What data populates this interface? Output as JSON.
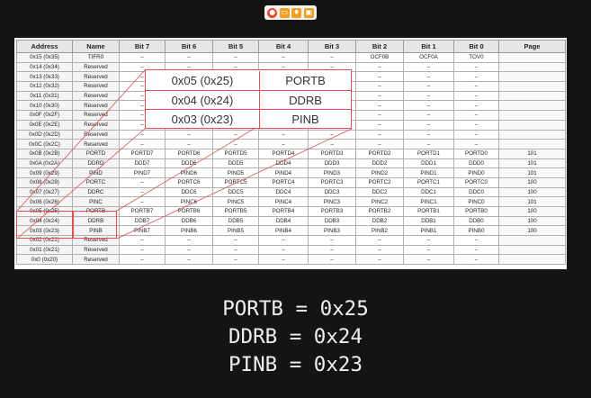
{
  "toolbar": {
    "icons": [
      "record-icon",
      "folder-icon",
      "mic-icon",
      "window-icon"
    ]
  },
  "table": {
    "headers": [
      "Address",
      "Name",
      "Bit 7",
      "Bit 6",
      "Bit 5",
      "Bit 4",
      "Bit 3",
      "Bit 2",
      "Bit 1",
      "Bit 0",
      "Page"
    ],
    "rows": [
      [
        "0x15 (0x35)",
        "TIFR0",
        "–",
        "–",
        "–",
        "–",
        "–",
        "OCF0B",
        "OCF0A",
        "TOV0",
        ""
      ],
      [
        "0x14 (0x34)",
        "Reserved",
        "–",
        "–",
        "–",
        "–",
        "–",
        "–",
        "–",
        "–",
        ""
      ],
      [
        "0x13 (0x33)",
        "Reserved",
        "–",
        "–",
        "–",
        "–",
        "–",
        "–",
        "–",
        "–",
        ""
      ],
      [
        "0x12 (0x32)",
        "Reserved",
        "–",
        "–",
        "–",
        "–",
        "–",
        "–",
        "–",
        "–",
        ""
      ],
      [
        "0x11 (0x31)",
        "Reserved",
        "–",
        "–",
        "–",
        "–",
        "–",
        "–",
        "–",
        "–",
        ""
      ],
      [
        "0x10 (0x30)",
        "Reserved",
        "–",
        "–",
        "–",
        "–",
        "–",
        "–",
        "–",
        "–",
        ""
      ],
      [
        "0x0F (0x2F)",
        "Reserved",
        "–",
        "–",
        "–",
        "–",
        "–",
        "–",
        "–",
        "–",
        ""
      ],
      [
        "0x0E (0x2E)",
        "Reserved",
        "–",
        "–",
        "–",
        "–",
        "–",
        "–",
        "–",
        "–",
        ""
      ],
      [
        "0x0D (0x2D)",
        "Reserved",
        "–",
        "–",
        "–",
        "–",
        "–",
        "–",
        "–",
        "–",
        ""
      ],
      [
        "0x0C (0x2C)",
        "Reserved",
        "–",
        "–",
        "–",
        "–",
        "–",
        "–",
        "–",
        "–",
        ""
      ],
      [
        "0x0B (0x2B)",
        "PORTD",
        "PORTD7",
        "PORTD6",
        "PORTD5",
        "PORTD4",
        "PORTD3",
        "PORTD2",
        "PORTD1",
        "PORTD0",
        "101"
      ],
      [
        "0x0A (0x2A)",
        "DDRD",
        "DDD7",
        "DDD6",
        "DDD5",
        "DDD4",
        "DDD3",
        "DDD2",
        "DDD1",
        "DDD0",
        "101"
      ],
      [
        "0x09 (0x29)",
        "PIND",
        "PIND7",
        "PIND6",
        "PIND5",
        "PIND4",
        "PIND3",
        "PIND2",
        "PIND1",
        "PIND0",
        "101"
      ],
      [
        "0x08 (0x28)",
        "PORTC",
        "–",
        "PORTC6",
        "PORTC5",
        "PORTC4",
        "PORTC3",
        "PORTC2",
        "PORTC1",
        "PORTC0",
        "100"
      ],
      [
        "0x07 (0x27)",
        "DDRC",
        "–",
        "DDC6",
        "DDC5",
        "DDC4",
        "DDC3",
        "DDC2",
        "DDC1",
        "DDC0",
        "100"
      ],
      [
        "0x06 (0x26)",
        "PINC",
        "–",
        "PINC6",
        "PINC5",
        "PINC4",
        "PINC3",
        "PINC2",
        "PINC1",
        "PINC0",
        "101"
      ],
      [
        "0x05 (0x25)",
        "PORTB",
        "PORTB7",
        "PORTB6",
        "PORTB5",
        "PORTB4",
        "PORTB3",
        "PORTB2",
        "PORTB1",
        "PORTB0",
        "100"
      ],
      [
        "0x04 (0x24)",
        "DDRB",
        "DDB7",
        "DDB6",
        "DDB5",
        "DDB4",
        "DDB3",
        "DDB2",
        "DDB1",
        "DDB0",
        "100"
      ],
      [
        "0x03 (0x23)",
        "PINB",
        "PINB7",
        "PINB6",
        "PINB5",
        "PINB4",
        "PINB3",
        "PINB2",
        "PINB1",
        "PINB0",
        "100"
      ],
      [
        "0x02 (0x22)",
        "Reserved",
        "–",
        "–",
        "–",
        "–",
        "–",
        "–",
        "–",
        "–",
        ""
      ],
      [
        "0x01 (0x21)",
        "Reserved",
        "–",
        "–",
        "–",
        "–",
        "–",
        "–",
        "–",
        "–",
        ""
      ],
      [
        "0x0 (0x20)",
        "Reserved",
        "–",
        "–",
        "–",
        "–",
        "–",
        "–",
        "–",
        "–",
        ""
      ]
    ]
  },
  "zoom_callout": {
    "rows": [
      {
        "address": "0x05 (0x25)",
        "name": "PORTB"
      },
      {
        "address": "0x04 (0x24)",
        "name": "DDRB"
      },
      {
        "address": "0x03 (0x23)",
        "name": "PINB"
      }
    ]
  },
  "equations": [
    "PORTB = 0x25",
    "DDRB = 0x24",
    "PINB = 0x23"
  ],
  "colors": {
    "background": "#141414",
    "highlight": "#e05050",
    "text_light": "#f0f0f0"
  }
}
